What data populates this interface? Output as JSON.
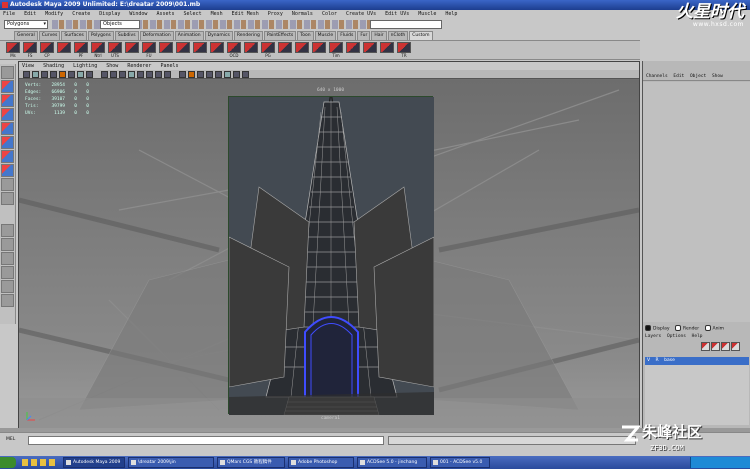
{
  "window": {
    "title": "Autodesk Maya 2009 Unlimited: E:\\dreatar 2009\\001.mb"
  },
  "logo": {
    "name": "火星时代",
    "url": "www.hxsd.com"
  },
  "menubar": [
    "File",
    "Edit",
    "Modify",
    "Create",
    "Display",
    "Window",
    "Assets",
    "Select",
    "Mesh",
    "Edit Mesh",
    "Proxy",
    "Normals",
    "Color",
    "Create UVs",
    "Edit UVs",
    "Muscle",
    "Help"
  ],
  "statusline": {
    "mode": "Polygons",
    "objects": "Objects"
  },
  "shelf": {
    "tabs": [
      "General",
      "Curves",
      "Surfaces",
      "Polygons",
      "Subdivs",
      "Deformation",
      "Animation",
      "Dynamics",
      "Rendering",
      "PaintEffects",
      "Toon",
      "Muscle",
      "Fluids",
      "Fur",
      "Hair",
      "nCloth",
      "Custom"
    ],
    "buttons": [
      "Ms",
      "FS",
      "CP",
      "",
      "PF",
      "Ntrl",
      "UTS",
      "",
      "FU",
      "",
      "",
      "",
      "",
      "OCD",
      "",
      "PG",
      "",
      "",
      "",
      "Tim",
      "",
      "",
      "",
      "TR"
    ]
  },
  "panel": {
    "menu": [
      "View",
      "Shading",
      "Lighting",
      "Show",
      "Renderer",
      "Panels"
    ],
    "resolution": "640 x 1000",
    "camera": "camera1",
    "hud": [
      {
        "label": "Verts:",
        "value": "28954",
        "a": "0",
        "b": "0"
      },
      {
        "label": "Edges:",
        "value": "66906",
        "a": "0",
        "b": "0"
      },
      {
        "label": "Faces:",
        "value": "39107",
        "a": "0",
        "b": "0"
      },
      {
        "label": "Tris:",
        "value": "39799",
        "a": "0",
        "b": "0"
      },
      {
        "label": "UVs:",
        "value": "1139",
        "a": "0",
        "b": "0"
      }
    ]
  },
  "channel_box": {
    "menu": [
      "Channels",
      "Edit",
      "Object",
      "Show"
    ],
    "display_modes": [
      "Display",
      "Render",
      "Anim"
    ],
    "selected_mode": "Display",
    "layer_menu": [
      "Layers",
      "Options",
      "Help"
    ],
    "layer": {
      "v": "V",
      "r": "R",
      "name": "base"
    }
  },
  "mel": {
    "label": "MEL"
  },
  "watermark": {
    "name": "朱峰社区",
    "url": "ZF3D.COM"
  },
  "taskbar": {
    "tasks": [
      "Autodesk Maya 2009",
      "\\dreatar 2009\\jin",
      "QMars CGS 教程稿件",
      "Adobe Photoshop",
      "ACDSee 5.0 - jinchang",
      "001 - ACDSee v5.0"
    ]
  },
  "colors": {
    "titlebar": "#1d3e8f",
    "viewport_bg": "#6d6d6d",
    "resolution_gate": "#434a52",
    "selection_blue": "#3a6ec8",
    "arch_highlight": "#3f4cff"
  }
}
